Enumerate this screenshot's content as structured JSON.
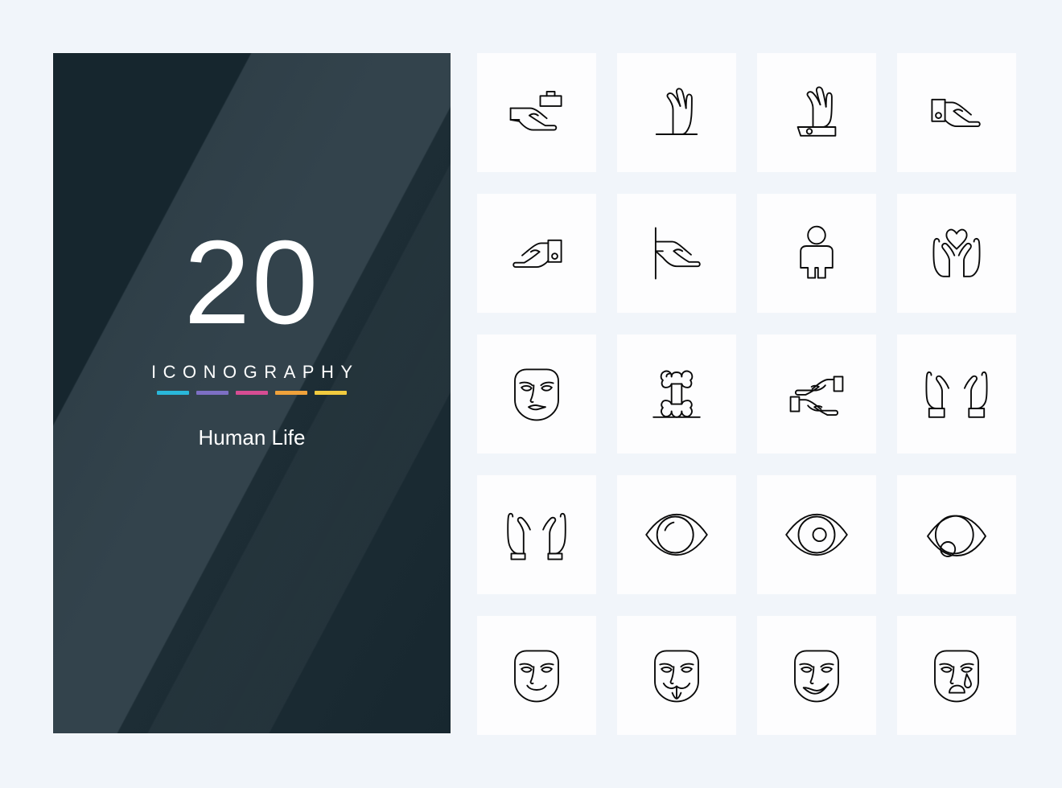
{
  "cover": {
    "count": "20",
    "word": "ICONOGRAPHY",
    "subject": "Human Life",
    "swatch_colors": [
      "#29b7da",
      "#7d6fc4",
      "#d74d93",
      "#f0a23b",
      "#f2cb3f"
    ],
    "background_dark": "#17272f",
    "background_light": "#34444d",
    "text_color": "#ffffff"
  },
  "page": {
    "background": "#f1f5fa",
    "tile_background": "#fdfdfe",
    "icon_stroke": "#0a0a0a"
  },
  "grid": {
    "columns": 4,
    "rows": 5,
    "icons": [
      {
        "name": "hand-holding-briefcase-icon",
        "label": "Hand Holding Briefcase"
      },
      {
        "name": "raised-hand-on-ground-icon",
        "label": "Raised Hand On Ground"
      },
      {
        "name": "raised-hand-with-cuff-icon",
        "label": "Raised Hand With Cuff"
      },
      {
        "name": "open-hand-right-with-cuff-icon",
        "label": "Open Hand Right With Cuff"
      },
      {
        "name": "open-hand-left-with-cuff-icon",
        "label": "Open Hand Left With Cuff"
      },
      {
        "name": "hand-on-pole-icon",
        "label": "Hand On Pole"
      },
      {
        "name": "person-standing-icon",
        "label": "Person Standing"
      },
      {
        "name": "hands-holding-heart-icon",
        "label": "Hands Holding Heart"
      },
      {
        "name": "face-mask-neutral-icon",
        "label": "Face Mask Neutral"
      },
      {
        "name": "bone-on-ground-icon",
        "label": "Bone On Ground"
      },
      {
        "name": "two-hands-facing-icon",
        "label": "Two Hands Facing"
      },
      {
        "name": "two-raised-hands-cuffed-icon",
        "label": "Two Raised Hands Cuffed"
      },
      {
        "name": "two-open-palms-icon",
        "label": "Two Open Palms"
      },
      {
        "name": "eye-blank-icon",
        "label": "Eye Blank"
      },
      {
        "name": "eye-with-pupil-icon",
        "label": "Eye With Pupil"
      },
      {
        "name": "eye-low-pupil-icon",
        "label": "Eye Low Pupil"
      },
      {
        "name": "face-mask-smiling-icon",
        "label": "Face Mask Smiling"
      },
      {
        "name": "face-mask-moustache-icon",
        "label": "Face Mask Moustache"
      },
      {
        "name": "face-mask-smirk-icon",
        "label": "Face Mask Smirk"
      },
      {
        "name": "face-mask-crying-icon",
        "label": "Face Mask Crying"
      }
    ]
  }
}
